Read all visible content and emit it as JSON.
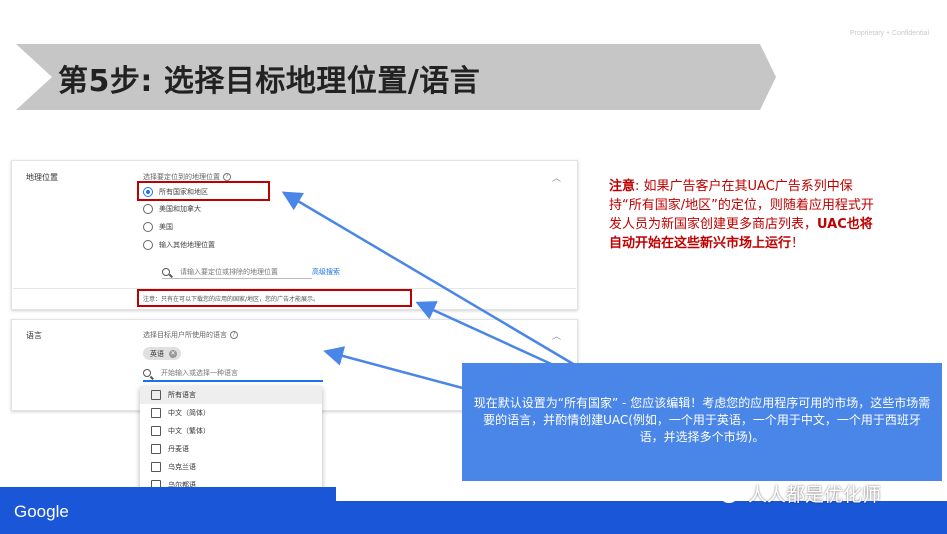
{
  "header": {
    "confidential": "Proprietary + Confidential",
    "title": "第5步: 选择目标地理位置/语言"
  },
  "geo_card": {
    "label": "地理位置",
    "subtitle": "选择要定位到的地理位置",
    "options": [
      {
        "label": "所有国家和地区",
        "selected": true
      },
      {
        "label": "美国和加拿大",
        "selected": false
      },
      {
        "label": "美国",
        "selected": false
      },
      {
        "label": "输入其他地理位置",
        "selected": false
      }
    ],
    "search_placeholder": "请输入要定位或排除的地理位置",
    "advanced_search": "高级搜索",
    "note": "注意：只有在可以下载您的应用的国家/地区，您的广告才能展示。"
  },
  "lang_card": {
    "label": "语言",
    "subtitle": "选择目标用户所使用的语言",
    "chip": "英语",
    "input_placeholder": "开始输入或选择一种语言",
    "options": [
      "所有语言",
      "中文（简体）",
      "中文（繁体）",
      "丹麦语",
      "乌克兰语",
      "乌尔都语",
      "俄语"
    ]
  },
  "annotation": {
    "prefix": "注意",
    "body": ": 如果广告客户在其UAC广告系列中保持“所有国家/地区”的定位，则随着应用程式开发人员为新国家创建更多商店列表，",
    "highlight": "UAC也将自动开始在这些新兴市场上运行",
    "suffix": "！"
  },
  "callout": {
    "text": "现在默认设置为“所有国家” - 您应该编辑！考虑您的应用程序可用的市场，这些市场需要的语言，并酌情创建UAC(例如，一个用于英语，一个用于中文，一个用于西班牙语，并选择多个市场)。"
  },
  "footer": {
    "logo": "Google",
    "watermark": "人人都是优化师"
  },
  "colors": {
    "accent_blue": "#4a86e8",
    "footer_blue": "#1a56d8",
    "highlight_red": "#c00000",
    "banner_gray": "#c6c6c6"
  }
}
